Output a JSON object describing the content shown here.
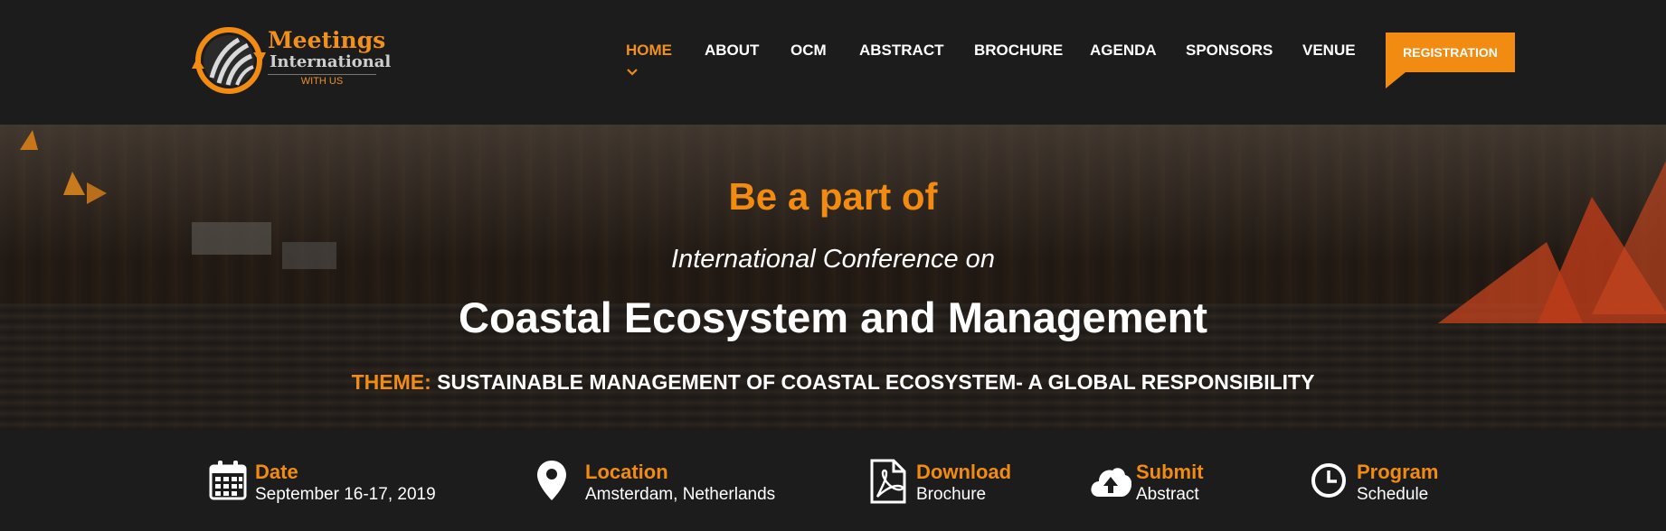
{
  "colors": {
    "accent": "#f28b12",
    "background": "#1c1c1c",
    "text": "#ffffff"
  },
  "logo": {
    "line1": "Meetings",
    "line2": "International",
    "line3": "WITH US"
  },
  "nav": {
    "items": [
      {
        "label": "HOME",
        "active": true
      },
      {
        "label": "ABOUT"
      },
      {
        "label": "OCM"
      },
      {
        "label": "ABSTRACT"
      },
      {
        "label": "BROCHURE"
      },
      {
        "label": "AGENDA"
      },
      {
        "label": "SPONSORS"
      },
      {
        "label": "VENUE"
      }
    ],
    "registration_label": "REGISTRATION",
    "active_indicator_icon": "chevron-down-icon"
  },
  "hero": {
    "line1": "Be a part of",
    "line2": "International Conference on",
    "line3": "Coastal Ecosystem and Management",
    "theme_label": "THEME:",
    "theme_text": "SUSTAINABLE MANAGEMENT OF COASTAL ECOSYSTEM- A GLOBAL RESPONSIBILITY"
  },
  "info": [
    {
      "icon": "calendar-icon",
      "title": "Date",
      "sub": "September 16-17, 2019"
    },
    {
      "icon": "map-pin-icon",
      "title": "Location",
      "sub": "Amsterdam, Netherlands"
    },
    {
      "icon": "pdf-file-icon",
      "title": "Download",
      "sub": "Brochure"
    },
    {
      "icon": "cloud-upload-icon",
      "title": "Submit",
      "sub": "Abstract"
    },
    {
      "icon": "clock-icon",
      "title": "Program",
      "sub": "Schedule"
    }
  ]
}
